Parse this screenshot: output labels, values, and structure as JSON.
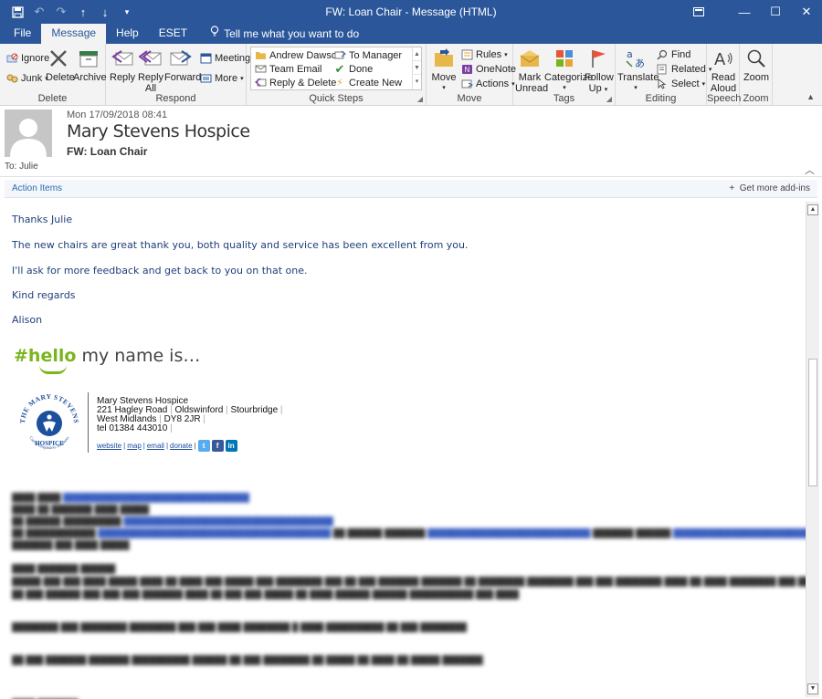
{
  "window": {
    "title": "FW: Loan Chair  -  Message (HTML)"
  },
  "tabs": [
    {
      "label": "File"
    },
    {
      "label": "Message"
    },
    {
      "label": "Help"
    },
    {
      "label": "ESET"
    }
  ],
  "tell_me": "Tell me what you want to do",
  "ribbon": {
    "delete_group": {
      "label": "Delete",
      "ignore": "Ignore",
      "junk": "Junk",
      "delete": "Delete",
      "archive": "Archive"
    },
    "respond_group": {
      "label": "Respond",
      "reply": "Reply",
      "reply_all_1": "Reply",
      "reply_all_2": "All",
      "forward": "Forward",
      "meeting": "Meeting",
      "more": "More"
    },
    "quick_steps_group": {
      "label": "Quick Steps",
      "items": [
        "Andrew Dawson",
        "To Manager",
        "Team Email",
        "Done",
        "Reply & Delete",
        "Create New"
      ]
    },
    "move_group": {
      "label": "Move",
      "move": "Move",
      "rules": "Rules",
      "onenote": "OneNote",
      "actions": "Actions"
    },
    "tags_group": {
      "label": "Tags",
      "mark_unread_1": "Mark",
      "mark_unread_2": "Unread",
      "categorize": "Categorize",
      "follow_up_1": "Follow",
      "follow_up_2": "Up"
    },
    "editing_group": {
      "label": "Editing",
      "translate": "Translate",
      "find": "Find",
      "related": "Related",
      "select": "Select"
    },
    "speech_group": {
      "label": "Speech",
      "read_aloud_1": "Read",
      "read_aloud_2": "Aloud"
    },
    "zoom_group": {
      "label": "Zoom",
      "zoom": "Zoom"
    }
  },
  "message": {
    "date": "Mon 17/09/2018 08:41",
    "sender": "Mary Stevens Hospice",
    "subject": "FW: Loan Chair",
    "to": "To: Julie"
  },
  "action_bar": {
    "action_items": "Action Items",
    "get_addins": "Get more add-ins"
  },
  "body": {
    "lines": [
      "Thanks Julie",
      "The new chairs are great thank you, both quality and service has been excellent from you.",
      "I'll ask for more feedback and get back to you on that one.",
      "Kind regards",
      "Alison"
    ],
    "hello_hash": "#",
    "hello_word": "hello",
    "hello_rest": " my name is…"
  },
  "signature": {
    "name": "Mary Stevens Hospice",
    "address_1": "221 Hagley Road",
    "address_2": "Oldswinford",
    "address_3": "Stourbridge",
    "address_4": "West Midlands",
    "postcode": "DY8 2JR",
    "tel": "tel 01384 443010",
    "links": [
      "website",
      "map",
      "email",
      "donate"
    ],
    "logo_top": "THE MARY STEVENS",
    "logo_mid": "HOSPICE",
    "logo_bottom": "Care, Compassion, Kindness"
  },
  "colors": {
    "accent": "#2b579a",
    "body_text": "#1f3f7a",
    "hello_green": "#7ab51d",
    "logo_blue": "#1c4f9c"
  }
}
